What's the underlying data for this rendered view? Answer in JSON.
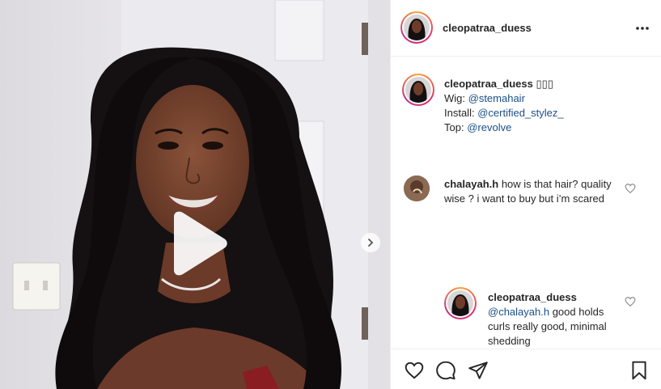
{
  "post": {
    "author": {
      "username": "cleopatraa_duess"
    },
    "caption": {
      "username": "cleopatraa_duess",
      "emoji": "▯▯▯",
      "lines": [
        {
          "label": "Wig:",
          "mention": "@stemahair"
        },
        {
          "label": "Install:",
          "mention": "@certified_stylez_"
        },
        {
          "label": "Top:",
          "mention": "@revolve"
        }
      ]
    },
    "comments": [
      {
        "username": "chalayah.h",
        "text": "how is that hair? quality wise ? i want to buy but i’m scared"
      },
      {
        "username": "cleopatraa_duess",
        "mention": "@chalayah.h",
        "text": "good holds curls really good, minimal shedding"
      }
    ],
    "icons": {
      "more": "more-options-icon",
      "play": "play-icon",
      "next": "chevron-right-icon",
      "like": "heart-icon",
      "comment": "comment-icon",
      "share": "share-icon",
      "save": "bookmark-icon"
    },
    "colors": {
      "mention": "#1b4f8a",
      "text": "#262626",
      "divider": "#efefef"
    }
  }
}
